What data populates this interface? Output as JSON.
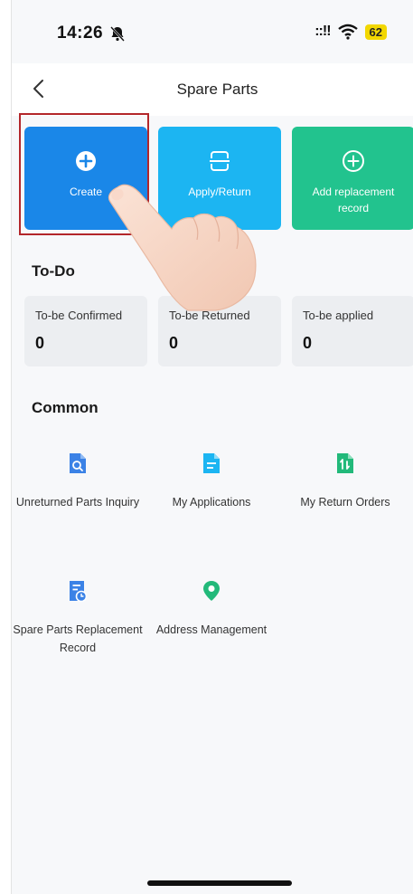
{
  "status_bar": {
    "time": "14:26",
    "signal": "::!!",
    "battery": "62"
  },
  "nav": {
    "title": "Spare Parts"
  },
  "actions": [
    {
      "label": "Create"
    },
    {
      "label": "Apply/Return"
    },
    {
      "label": "Add replacement record"
    }
  ],
  "todo": {
    "title": "To-Do",
    "items": [
      {
        "label": "To-be Confirmed",
        "count": "0"
      },
      {
        "label": "To-be Returned",
        "count": "0"
      },
      {
        "label": "To-be applied",
        "count": "0"
      }
    ]
  },
  "common": {
    "title": "Common",
    "items": [
      {
        "label": "Unreturned Parts Inquiry",
        "icon": "document-search-icon",
        "color": "#3b82e6"
      },
      {
        "label": "My Applications",
        "icon": "document-icon",
        "color": "#1cb5f2"
      },
      {
        "label": "My Return Orders",
        "icon": "return-document-icon",
        "color": "#22b97a"
      },
      {
        "label": "Spare Parts Replacement Record",
        "icon": "document-clock-icon",
        "color": "#3b82e6"
      },
      {
        "label": "Address Management",
        "icon": "location-pin-icon",
        "color": "#22b97a"
      }
    ]
  },
  "colors": {
    "create": "#1a87e8",
    "apply": "#1cb5f2",
    "add": "#22c38e",
    "highlight": "#b3262a"
  }
}
